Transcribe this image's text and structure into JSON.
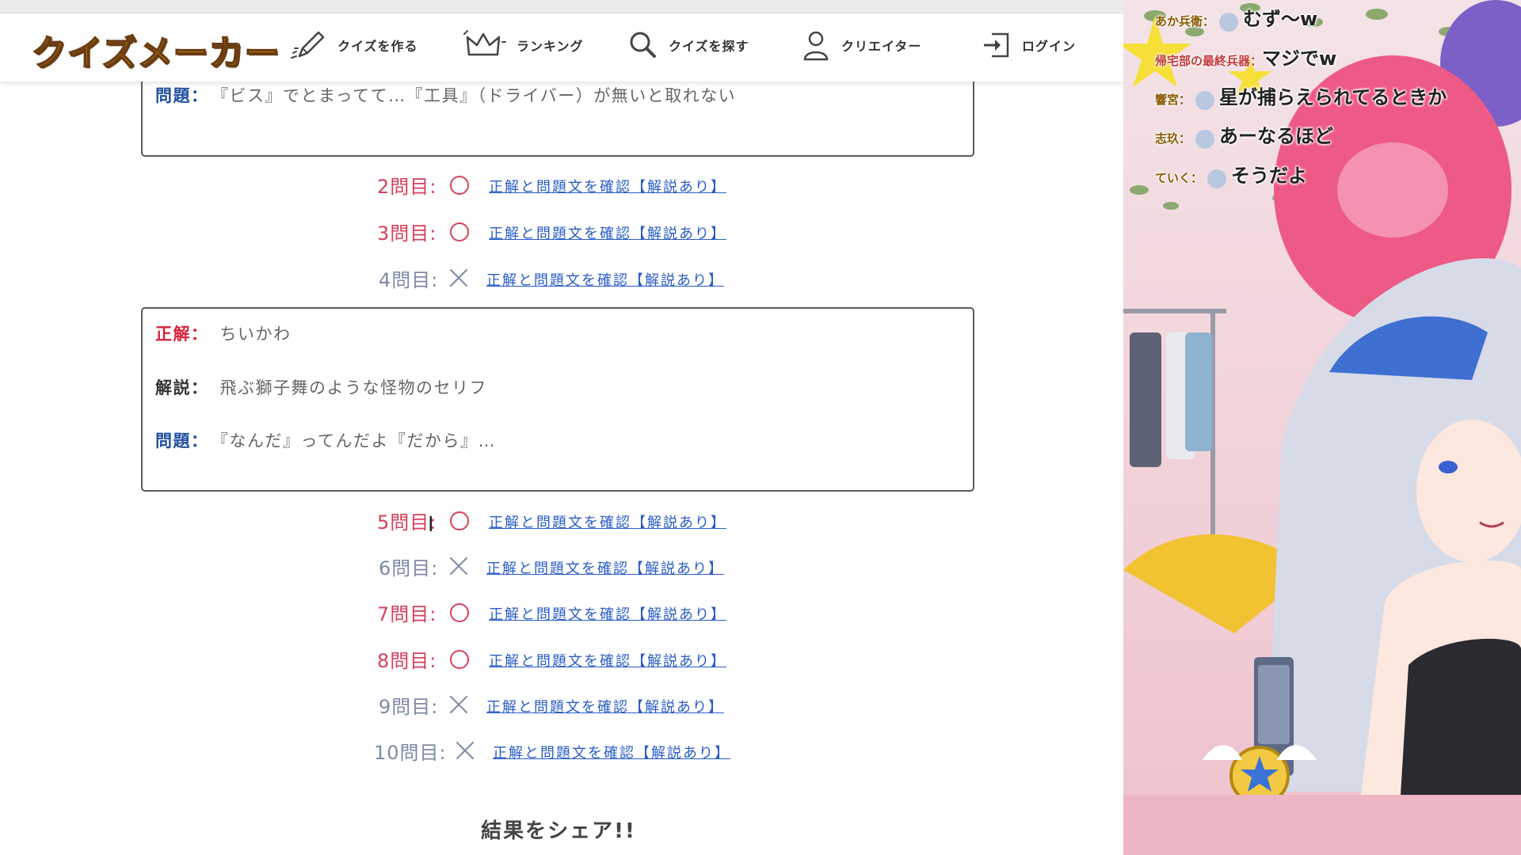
{
  "site": {
    "logo": "クイズメーカー",
    "nav": [
      {
        "label": "クイズを作る",
        "icon": "pen-icon"
      },
      {
        "label": "ランキング",
        "icon": "crown-icon"
      },
      {
        "label": "クイズを探す",
        "icon": "search-icon"
      },
      {
        "label": "クリエイター",
        "icon": "user-icon"
      },
      {
        "label": "ログイン",
        "icon": "login-icon"
      }
    ]
  },
  "detail_box_1": {
    "question_label": "問題：",
    "question_text": "『ビス』でとまってて…『工具』（ドライバー）が無いと取れない"
  },
  "results_a": [
    {
      "label": "2問目:",
      "correct": true,
      "link": "正解と問題文を確認【解説あり】"
    },
    {
      "label": "3問目:",
      "correct": true,
      "link": "正解と問題文を確認【解説あり】"
    },
    {
      "label": "4問目:",
      "correct": false,
      "link": "正解と問題文を確認【解説あり】"
    }
  ],
  "detail_box_2": {
    "answer_label": "正解：",
    "answer_text": "ちいかわ",
    "explanation_label": "解説：",
    "explanation_text": "飛ぶ獅子舞のような怪物のセリフ",
    "question_label": "問題：",
    "question_text": "『なんだ』ってんだよ『だから』…"
  },
  "results_b": [
    {
      "label": "5問目:",
      "correct": true,
      "link": "正解と問題文を確認【解説あり】"
    },
    {
      "label": "6問目:",
      "correct": false,
      "link": "正解と問題文を確認【解説あり】"
    },
    {
      "label": "7問目:",
      "correct": true,
      "link": "正解と問題文を確認【解説あり】"
    },
    {
      "label": "8問目:",
      "correct": true,
      "link": "正解と問題文を確認【解説あり】"
    },
    {
      "label": "9問目:",
      "correct": false,
      "link": "正解と問題文を確認【解説あり】"
    },
    {
      "label": "10問目:",
      "correct": false,
      "link": "正解と問題文を確認【解説あり】"
    }
  ],
  "share_label": "結果をシェア!!",
  "chat": [
    {
      "name": "あか兵衛：",
      "message": "むず～w"
    },
    {
      "name": "帰宅部の最終兵器：",
      "message": "マジでw"
    },
    {
      "name": "響宮：",
      "message": "星が捕らえられてるときか"
    },
    {
      "name": "志玖：",
      "message": "あーなるほど"
    },
    {
      "name": "ていく：",
      "message": "そうだよ"
    }
  ],
  "colors": {
    "correct": "#d9405a",
    "incorrect": "#7d8aa8",
    "link": "#2a5cc8",
    "label_blue": "#1f4fa0",
    "label_red": "#d8203c"
  }
}
